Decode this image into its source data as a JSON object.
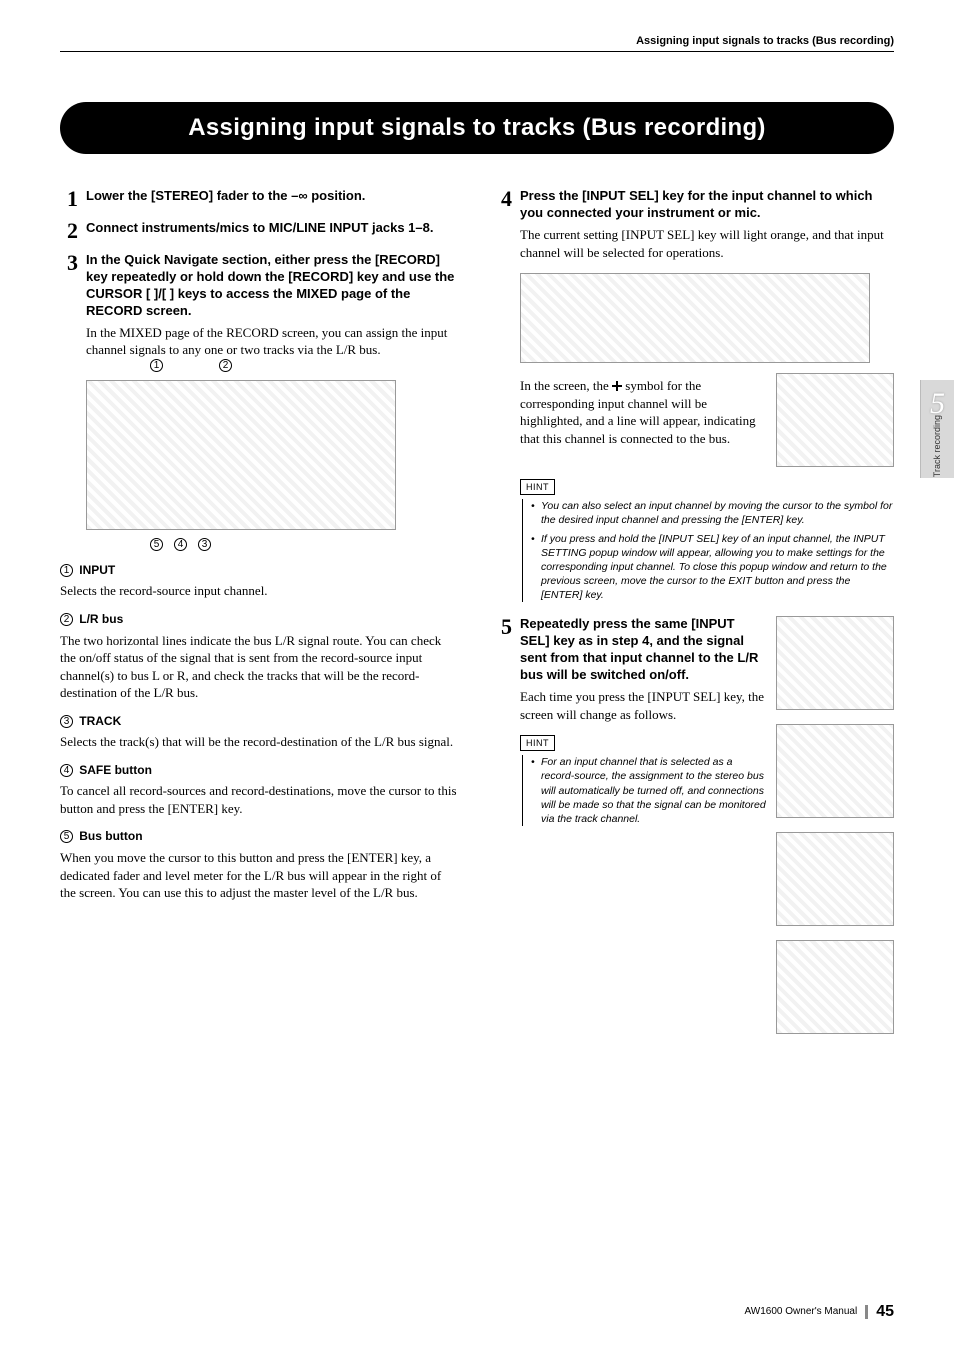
{
  "running_head": "Assigning input signals to tracks (Bus recording)",
  "title": "Assigning input signals to tracks (Bus recording)",
  "sidebar": {
    "chapter_num": "5",
    "chapter_label": "Track recording"
  },
  "left": {
    "step1": {
      "num": "1",
      "label": "Lower the [STEREO] fader to the –∞ position."
    },
    "step2": {
      "num": "2",
      "label": "Connect instruments/mics to MIC/LINE INPUT jacks 1–8."
    },
    "step3": {
      "num": "3",
      "label": "In the Quick Navigate section, either press the [RECORD] key repeatedly or hold down the [RECORD] key and use the CURSOR [   ]/[   ] keys to access the MIXED page of the RECORD screen.",
      "body": "In the MIXED page of the RECORD screen, you can assign the input channel signals to any one or two tracks via the L/R bus."
    },
    "callouts_top": [
      "1",
      "2"
    ],
    "callouts_bot": [
      "5",
      "4",
      "3"
    ],
    "sub1": {
      "num": "1",
      "head": "INPUT",
      "body": "Selects the record-source input channel."
    },
    "sub2": {
      "num": "2",
      "head": "L/R bus",
      "body": "The two horizontal lines indicate the bus L/R signal route. You can check the on/off status of the signal that is sent from the record-source input channel(s) to bus L or R, and check the tracks that will be the record-destination of the L/R bus."
    },
    "sub3": {
      "num": "3",
      "head": "TRACK",
      "body": "Selects the track(s) that will be the record-destination of the L/R bus signal."
    },
    "sub4": {
      "num": "4",
      "head": "SAFE button",
      "body": "To cancel all record-sources and record-destinations, move the cursor to this button and press the [ENTER] key."
    },
    "sub5": {
      "num": "5",
      "head": "Bus button",
      "body": "When you move the cursor to this button and press the [ENTER] key, a dedicated fader and level meter for the L/R bus will appear in the right of the screen. You can use this to adjust the master level of the L/R bus."
    }
  },
  "right": {
    "step4": {
      "num": "4",
      "label": "Press the [INPUT SEL] key for the input channel to which you connected your instrument or mic.",
      "body": "The current setting [INPUT SEL] key will light orange, and that input channel will be selected for operations.",
      "body2a": "In the screen, the ",
      "body2b": " symbol for the corresponding input channel will be highlighted, and a line will appear, indicating that this channel is connected to the bus."
    },
    "hint1": {
      "label": "HINT",
      "items": [
        "You can also select an input channel by moving the cursor to the      symbol for the desired input channel and pressing the [ENTER] key.",
        "If you press and hold the [INPUT SEL] key of an input channel, the INPUT SETTING popup window will appear, allowing you to make settings for the corresponding input channel. To close this popup window and return to the previous screen, move the cursor to the EXIT button and press the [ENTER] key."
      ]
    },
    "step5": {
      "num": "5",
      "label": "Repeatedly press the same [INPUT SEL] key as in step 4, and the signal sent from that input channel to the L/R bus will be switched on/off.",
      "body": "Each time you press the [INPUT SEL] key, the screen will change as follows."
    },
    "hint2": {
      "label": "HINT",
      "items": [
        "For an input channel that is selected as a record-source, the assignment to the stereo bus will automatically be turned off, and connections will be made so that the signal can be monitored via the track channel."
      ]
    }
  },
  "footer": {
    "product": "AW1600  Owner's Manual",
    "page": "45"
  }
}
